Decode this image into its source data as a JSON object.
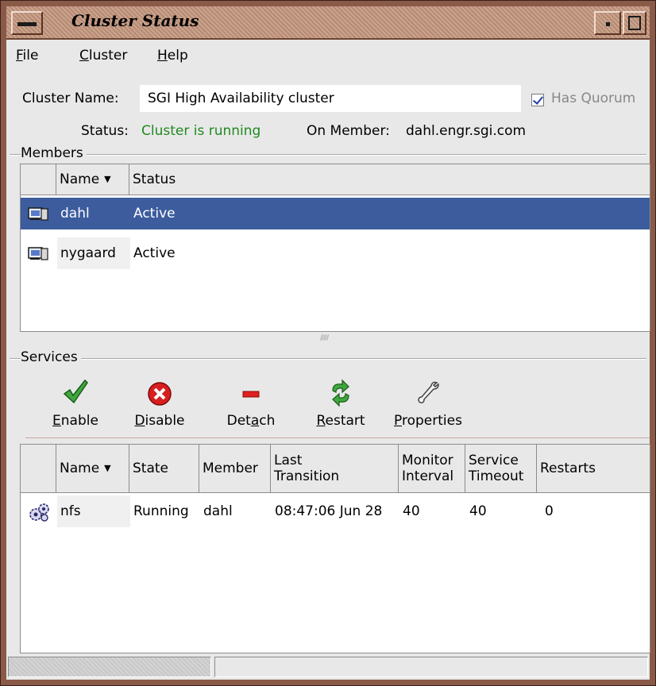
{
  "window": {
    "title": "Cluster Status"
  },
  "menu": {
    "items": [
      {
        "label": "File",
        "accel": "F",
        "rest": "ile"
      },
      {
        "label": "Cluster",
        "accel": "C",
        "rest": "luster"
      },
      {
        "label": "Help",
        "accel": "H",
        "rest": "elp"
      }
    ]
  },
  "cluster": {
    "name_label": "Cluster Name:",
    "name_value": "SGI High Availability cluster",
    "quorum_label": "Has Quorum",
    "quorum_checked": true,
    "status_label": "Status:",
    "status_value": "Cluster is running",
    "status_color": "#1f8a1f",
    "member_label": "On Member:",
    "member_value": "dahl.engr.sgi.com"
  },
  "members": {
    "frame_title": "Members",
    "columns": [
      "Name",
      "Status"
    ],
    "rows": [
      {
        "name": "dahl",
        "status": "Active",
        "selected": true
      },
      {
        "name": "nygaard",
        "status": "Active",
        "selected": false
      }
    ]
  },
  "services": {
    "frame_title": "Services",
    "toolbar": [
      {
        "label": "Enable",
        "accel": "E",
        "pre": "",
        "post": "nable",
        "icon": "check-icon"
      },
      {
        "label": "Disable",
        "accel": "D",
        "pre": "",
        "post": "isable",
        "icon": "stop-icon"
      },
      {
        "label": "Detach",
        "accel": "a",
        "pre": "Det",
        "post": "ch",
        "icon": "minus-icon"
      },
      {
        "label": "Restart",
        "accel": "R",
        "pre": "",
        "post": "estart",
        "icon": "restart-icon"
      },
      {
        "label": "Properties",
        "accel": "P",
        "pre": "",
        "post": "roperties",
        "icon": "wrench-icon"
      }
    ],
    "columns": [
      "Name",
      "State",
      "Member",
      "Last Transition",
      "Monitor Interval",
      "Service Timeout",
      "Restarts"
    ],
    "column_lines": [
      [
        "Name"
      ],
      [
        "State"
      ],
      [
        "Member"
      ],
      [
        "Last",
        "Transition"
      ],
      [
        "Monitor",
        "Interval"
      ],
      [
        "Service",
        "Timeout"
      ],
      [
        "Restarts"
      ]
    ],
    "rows": [
      {
        "name": "nfs",
        "state": "Running",
        "member": "dahl",
        "last_transition": "08:47:06 Jun 28",
        "monitor_interval": "40",
        "service_timeout": "40",
        "restarts": "0"
      }
    ]
  },
  "colors": {
    "selection": "#3c5c9e",
    "window_frame": "#8a5a48"
  }
}
